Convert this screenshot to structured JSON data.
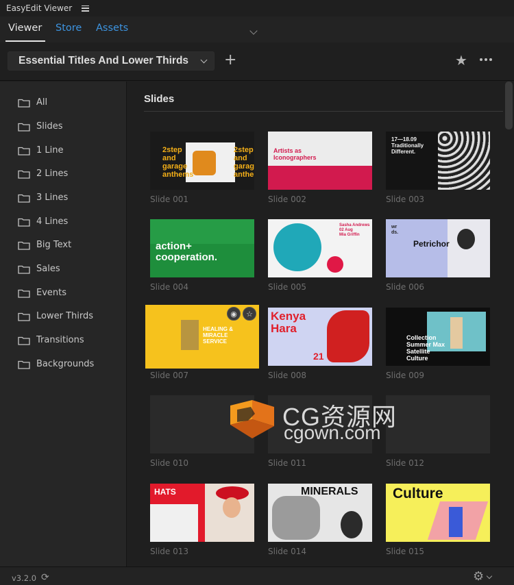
{
  "window": {
    "title": "EasyEdit Viewer"
  },
  "tabs": [
    {
      "label": "Viewer",
      "active": true
    },
    {
      "label": "Store",
      "active": false
    },
    {
      "label": "Assets",
      "active": false
    }
  ],
  "collection": {
    "selected": "Essential Titles And Lower Thirds"
  },
  "sidebar": {
    "items": [
      {
        "label": "All"
      },
      {
        "label": "Slides"
      },
      {
        "label": "1 Line"
      },
      {
        "label": "2 Lines"
      },
      {
        "label": "3 Lines"
      },
      {
        "label": "4 Lines"
      },
      {
        "label": "Big Text"
      },
      {
        "label": "Sales"
      },
      {
        "label": "Events"
      },
      {
        "label": "Lower Thirds"
      },
      {
        "label": "Transitions"
      },
      {
        "label": "Backgrounds"
      }
    ]
  },
  "main": {
    "section_title": "Slides",
    "cards": [
      {
        "caption": "Slide 001",
        "text": [
          "2step",
          "and",
          "garage",
          "anthems"
        ]
      },
      {
        "caption": "Slide 002",
        "text": [
          "Artists as",
          "Iconographers"
        ]
      },
      {
        "caption": "Slide 003",
        "text": [
          "17—18.09",
          "Traditionally",
          "Different."
        ]
      },
      {
        "caption": "Slide 004",
        "text": [
          "action+",
          "cooperation."
        ]
      },
      {
        "caption": "Slide 005",
        "text": [
          "Sasha Andrews",
          "02 Aug",
          "Mia Griffin"
        ]
      },
      {
        "caption": "Slide 006",
        "text": [
          "wr",
          "ds.",
          "Petrichor"
        ]
      },
      {
        "caption": "Slide 007",
        "text": [
          "HEALING &",
          "MIRACLE",
          "SERVICE"
        ]
      },
      {
        "caption": "Slide 008",
        "text": [
          "Kenya",
          "Hara",
          "21"
        ]
      },
      {
        "caption": "Slide 009",
        "text": [
          "Collection",
          "Summer Max",
          "Satellite",
          "Culture"
        ]
      },
      {
        "caption": "Slide 010",
        "text": []
      },
      {
        "caption": "Slide 011",
        "text": []
      },
      {
        "caption": "Slide 012",
        "text": []
      },
      {
        "caption": "Slide 013",
        "text": [
          "HATS"
        ]
      },
      {
        "caption": "Slide 014",
        "text": [
          "MINERALS"
        ]
      },
      {
        "caption": "Slide 015",
        "text": [
          "Culture"
        ]
      }
    ]
  },
  "watermark": {
    "cn": "CG资源网",
    "en": "cgown.com"
  },
  "footer": {
    "version": "v3.2.0"
  },
  "colors": {
    "accent": "#3d94e0",
    "background": "#1f1f1f",
    "sidebar": "#262626"
  }
}
